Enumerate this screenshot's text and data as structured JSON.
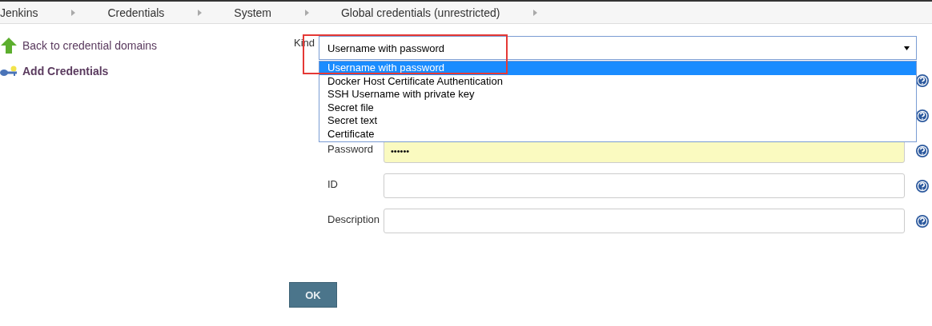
{
  "breadcrumbs": [
    {
      "label": "Jenkins"
    },
    {
      "label": "Credentials"
    },
    {
      "label": "System"
    },
    {
      "label": "Global credentials (unrestricted)"
    }
  ],
  "sidebar": {
    "items": [
      {
        "kind": "back",
        "label": "Back to credential domains",
        "selected": false
      },
      {
        "kind": "key",
        "label": "Add Credentials",
        "selected": true
      }
    ]
  },
  "kind_field": {
    "label": "Kind",
    "value": "Username with password",
    "expanded": true,
    "options": [
      {
        "label": "Username with password",
        "selected": true
      },
      {
        "label": "Docker Host Certificate Authentication",
        "selected": false
      },
      {
        "label": "SSH Username with private key",
        "selected": false
      },
      {
        "label": "Secret file",
        "selected": false
      },
      {
        "label": "Secret text",
        "selected": false
      },
      {
        "label": "Certificate",
        "selected": false
      }
    ]
  },
  "rows": [
    {
      "kind": "covered"
    },
    {
      "kind": "covered"
    },
    {
      "kind": "password",
      "label": "Password",
      "value": "••••••"
    },
    {
      "kind": "text",
      "label": "ID"
    },
    {
      "kind": "text",
      "label": "Description"
    }
  ],
  "ok_button": {
    "label": "OK"
  }
}
